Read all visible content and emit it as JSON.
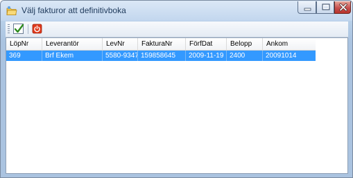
{
  "window": {
    "title": "Välj fakturor att definitivboka",
    "icon": "folder-icon"
  },
  "title_controls": {
    "minimize_icon": "minimize-icon",
    "maximize_icon": "maximize-icon",
    "close_icon": "close-icon"
  },
  "toolbar": {
    "buttons": [
      {
        "icon": "checkmark-icon",
        "color": "#2e8b1e"
      },
      {
        "icon": "power-stop-icon",
        "color": "#e0391b"
      }
    ]
  },
  "list": {
    "columns": [
      "LöpNr",
      "Leverantör",
      "LevNr",
      "FakturaNr",
      "FörfDat",
      "Belopp",
      "Ankom"
    ],
    "rows": [
      [
        "369",
        "Brf Ekem",
        "5580-9347",
        "159858645",
        "2009-11-19",
        "2400",
        "20091014"
      ]
    ],
    "selected_row": 0,
    "selection_color": "#3399ff"
  }
}
